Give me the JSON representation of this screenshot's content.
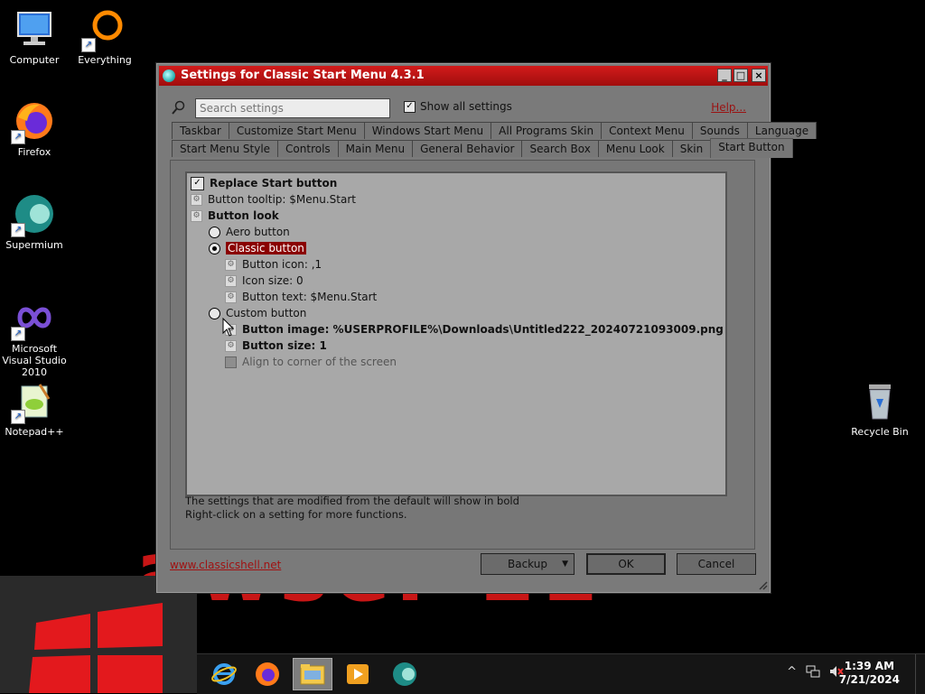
{
  "desktop": {
    "background_text": "awser 11",
    "icons": [
      {
        "label": "Computer"
      },
      {
        "label": "Everything"
      },
      {
        "label": "Firefox"
      },
      {
        "label": "Supermium"
      },
      {
        "label": "Microsoft Visual Studio 2010"
      },
      {
        "label": "Notepad++"
      },
      {
        "label": "Recycle Bin"
      }
    ]
  },
  "taskbar": {
    "clock_time": "1:39 AM",
    "clock_date": "7/21/2024",
    "tray_chevron": "^"
  },
  "window": {
    "title": "Settings for Classic Start Menu 4.3.1",
    "search_placeholder": "Search settings",
    "show_all_label": "Show all settings",
    "show_all_checked": true,
    "help_label": "Help...",
    "tabs_row1": [
      "Taskbar",
      "Customize Start Menu",
      "Windows Start Menu",
      "All Programs Skin",
      "Context Menu",
      "Sounds",
      "Language"
    ],
    "tabs_row2": [
      "Start Menu Style",
      "Controls",
      "Main Menu",
      "General Behavior",
      "Search Box",
      "Menu Look",
      "Skin",
      "Start Button"
    ],
    "selected_tab": "Start Button",
    "settings": {
      "replace_start_button": "Replace Start button",
      "button_tooltip": "Button tooltip: $Menu.Start",
      "button_look": "Button look",
      "aero_button": "Aero button",
      "classic_button": "Classic button",
      "button_icon": "Button icon: ,1",
      "icon_size": "Icon size: 0",
      "button_text": "Button text: $Menu.Start",
      "custom_button": "Custom button",
      "button_image": "Button image: %USERPROFILE%\\Downloads\\Untitled222_20240721093009.png",
      "button_size": "Button size: 1",
      "align_corner": "Align to corner of the screen"
    },
    "info_line1": "The settings that are modified from the default will show in bold",
    "info_line2": "Right-click on a setting for more functions.",
    "site_link": "www.classicshell.net",
    "backup_label": "Backup",
    "ok_label": "OK",
    "cancel_label": "Cancel"
  },
  "colors": {
    "titlebar": "#c41414",
    "accent_red": "#8a0000",
    "window_bg": "#7a7a7a",
    "tree_bg": "#a8a8a8"
  }
}
